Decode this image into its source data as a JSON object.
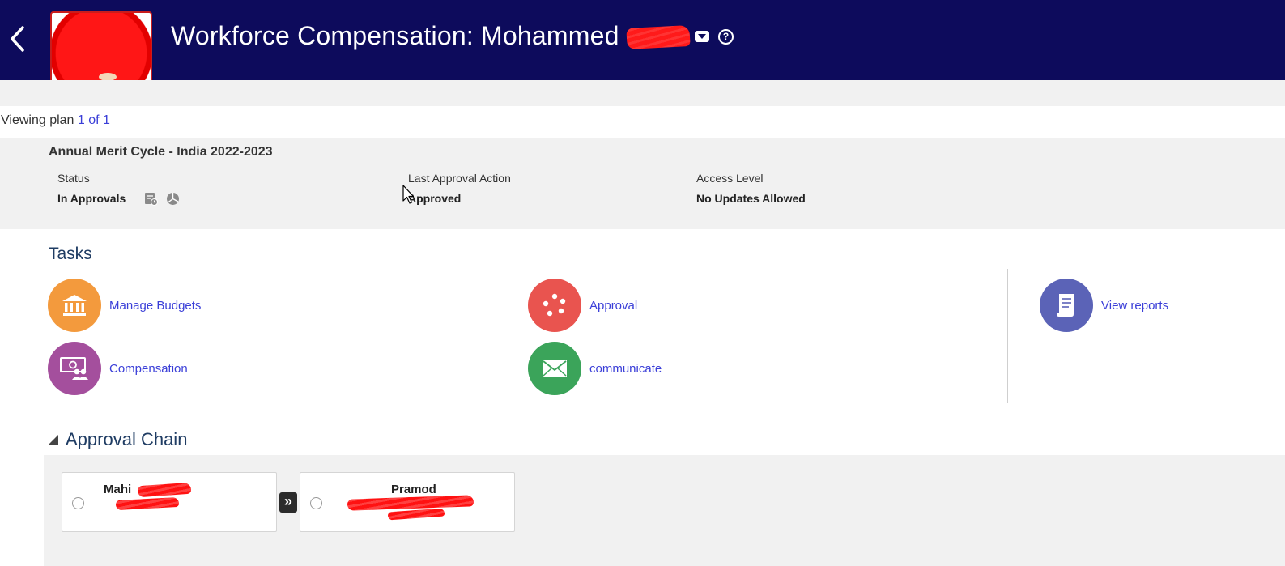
{
  "header": {
    "title": "Workforce Compensation: Mohammed",
    "help_glyph": "?",
    "back_icon": "chevron-left-icon",
    "menu_icon": "dropdown-caret-icon",
    "bg_color": "#0d0b5c"
  },
  "viewing": {
    "prefix": "Viewing plan",
    "link": "1 of 1"
  },
  "plan": {
    "name": "Annual Merit Cycle - India 2022-2023",
    "status_label": "Status",
    "status_value": "In Approvals",
    "last_action_label": "Last Approval Action",
    "last_action_value": "Approved",
    "access_label": "Access Level",
    "access_value": "No Updates Allowed"
  },
  "tasks": {
    "heading": "Tasks",
    "items": [
      {
        "label": "Manage Budgets",
        "icon": "bank-icon",
        "color": "#f39a3d"
      },
      {
        "label": "Approval",
        "icon": "cycle-icon",
        "color": "#e9544f"
      },
      {
        "label": "View reports",
        "icon": "report-icon",
        "color": "#5b63b7"
      },
      {
        "label": "Compensation",
        "icon": "money-people-icon",
        "color": "#a44f9d"
      },
      {
        "label": "communicate",
        "icon": "envelope-icon",
        "color": "#3ba45a"
      }
    ]
  },
  "approval_chain": {
    "title": "Approval Chain",
    "approvers": [
      {
        "name": "Mahi"
      },
      {
        "name": "Pramod"
      }
    ],
    "arrow": "»"
  }
}
